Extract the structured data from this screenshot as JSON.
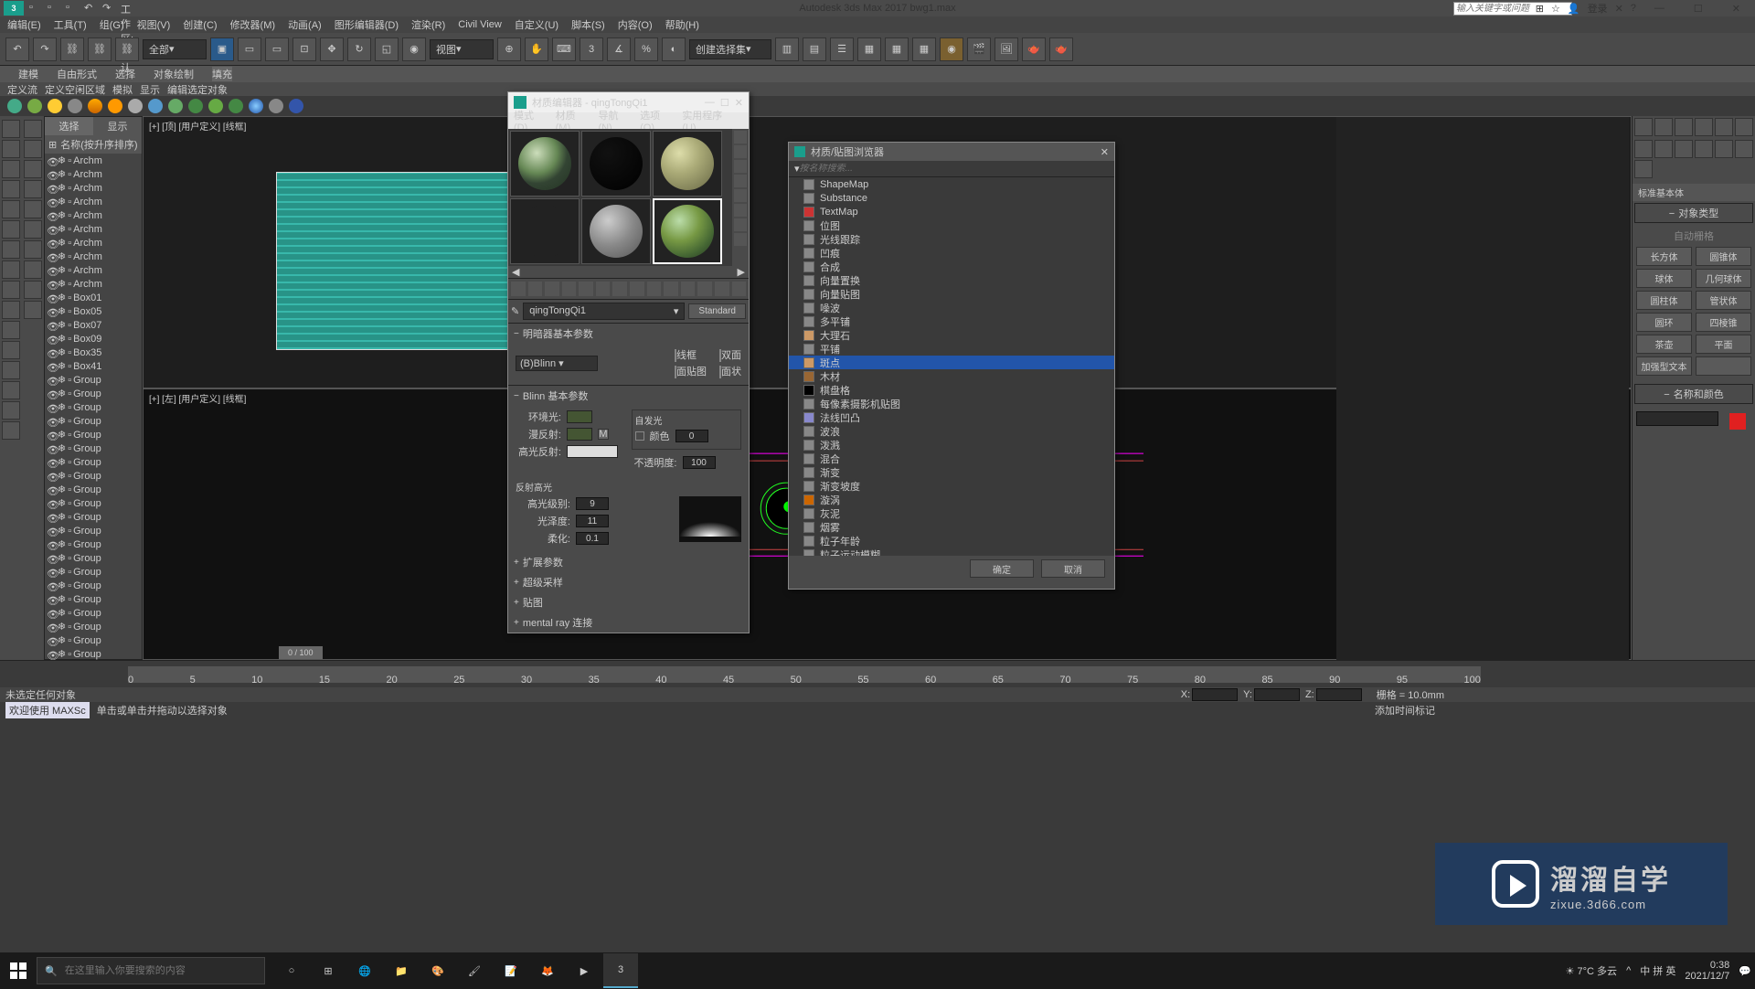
{
  "titlebar": {
    "workspace_label": "工作区: 默认",
    "title": "Autodesk 3ds Max 2017   bwg1.max",
    "search_placeholder": "输入关键字或问题",
    "login": "登录"
  },
  "menubar": [
    "编辑(E)",
    "工具(T)",
    "组(G)",
    "视图(V)",
    "创建(C)",
    "修改器(M)",
    "动画(A)",
    "图形编辑器(D)",
    "渲染(R)",
    "Civil View",
    "自定义(U)",
    "脚本(S)",
    "内容(O)",
    "帮助(H)"
  ],
  "ribbon_tabs": [
    "建模",
    "自由形式",
    "选择",
    "对象绘制",
    "填充"
  ],
  "subribbon": [
    "定义流",
    "定义空闲区域",
    "模拟",
    "显示",
    "编辑选定对象"
  ],
  "toolbar": {
    "combo1": "全部",
    "combo2": "视图",
    "combo3": "创建选择集"
  },
  "scene": {
    "sort_label": "名称(按升序排序)",
    "items": [
      "Archm",
      "Archm",
      "Archm",
      "Archm",
      "Archm",
      "Archm",
      "Archm",
      "Archm",
      "Archm",
      "Archm",
      "Box01",
      "Box05",
      "Box07",
      "Box09",
      "Box35",
      "Box41",
      "Group",
      "Group",
      "Group",
      "Group",
      "Group",
      "Group",
      "Group",
      "Group",
      "Group",
      "Group",
      "Group",
      "Group",
      "Group",
      "Group",
      "Group",
      "Group",
      "Group",
      "Group",
      "Group",
      "Group",
      "Group",
      "Group"
    ]
  },
  "viewport": {
    "top_label": "[+] [顶] [用户定义] [线框]",
    "bottom_label": "[+] [左] [用户定义] [线框]",
    "tab_sel": "选择",
    "tab_disp": "显示"
  },
  "right_panel": {
    "header": "标准基本体",
    "sect_type": "对象类型",
    "auto_grid": "自动栅格",
    "primitives": [
      [
        "长方体",
        "圆锥体"
      ],
      [
        "球体",
        "几何球体"
      ],
      [
        "圆柱体",
        "管状体"
      ],
      [
        "圆环",
        "四棱锥"
      ],
      [
        "茶壶",
        "平面"
      ],
      [
        "加强型文本",
        ""
      ]
    ],
    "name_color": "名称和颜色"
  },
  "timeline": {
    "slider": "0 / 100",
    "marks": [
      "0",
      "5",
      "10",
      "15",
      "20",
      "25",
      "30",
      "35",
      "40",
      "45",
      "50",
      "55",
      "60",
      "65",
      "70",
      "75",
      "80",
      "85",
      "90",
      "95",
      "100"
    ]
  },
  "status1": "未选定任何对象",
  "status_left": "欢迎使用 MAXSc",
  "status2": "单击或单击并拖动以选择对象",
  "coords": {
    "x": "X:",
    "y": "Y:",
    "z": "Z:",
    "grid": "栅格 = 10.0mm",
    "addkey": "添加时间标记"
  },
  "material_editor": {
    "title": "材质编辑器 - qingTongQi1",
    "menu": [
      "模式(D)",
      "材质(M)",
      "导航(N)",
      "选项(O)",
      "实用程序(U)",
      ""
    ],
    "name": "qingTongQi1",
    "standard": "Standard",
    "sect_shader": "明暗器基本参数",
    "shader": "(B)Blinn",
    "opts": {
      "wire": "线框",
      "two": "双面",
      "facemap": "面贴图",
      "faceted": "面状"
    },
    "sect_blinn": "Blinn 基本参数",
    "ambient": "环境光:",
    "diffuse": "漫反射:",
    "specular": "高光反射:",
    "self_illum": "自发光",
    "color_cb": "颜色",
    "opacity": "不透明度:",
    "self_val": "0",
    "opac_val": "100",
    "sect_refl": "反射高光",
    "spec_level": "高光级别:",
    "spec_val": "9",
    "gloss": "光泽度:",
    "gloss_val": "11",
    "soften": "柔化:",
    "soften_val": "0.1",
    "sect_ext": "扩展参数",
    "sect_ss": "超级采样",
    "sect_maps": "贴图",
    "sect_mr": "mental ray 连接"
  },
  "browser": {
    "title": "材质/贴图浏览器",
    "search_placeholder": "按名称搜索...",
    "items": [
      "ShapeMap",
      "Substance",
      "TextMap",
      "位图",
      "光线跟踪",
      "凹痕",
      "合成",
      "向量置换",
      "向量贴图",
      "噪波",
      "多平铺",
      "大理石",
      "平铺",
      "斑点",
      "木材",
      "棋盘格",
      "每像素摄影机贴图",
      "法线凹凸",
      "波浪",
      "泼溅",
      "混合",
      "渐变",
      "渐变坡度",
      "漩涡",
      "灰泥",
      "烟雾",
      "粒子年龄",
      "粒子运动模糊"
    ],
    "selected_index": 13,
    "ok": "确定",
    "cancel": "取消"
  },
  "watermark": {
    "line1": "溜溜自学",
    "line2": "zixue.3d66.com"
  },
  "taskbar": {
    "search_placeholder": "在这里输入你要搜索的内容",
    "weather": "7°C 多云",
    "ime": "中 拼 英",
    "time": "0:38",
    "date": "2021/12/7"
  }
}
